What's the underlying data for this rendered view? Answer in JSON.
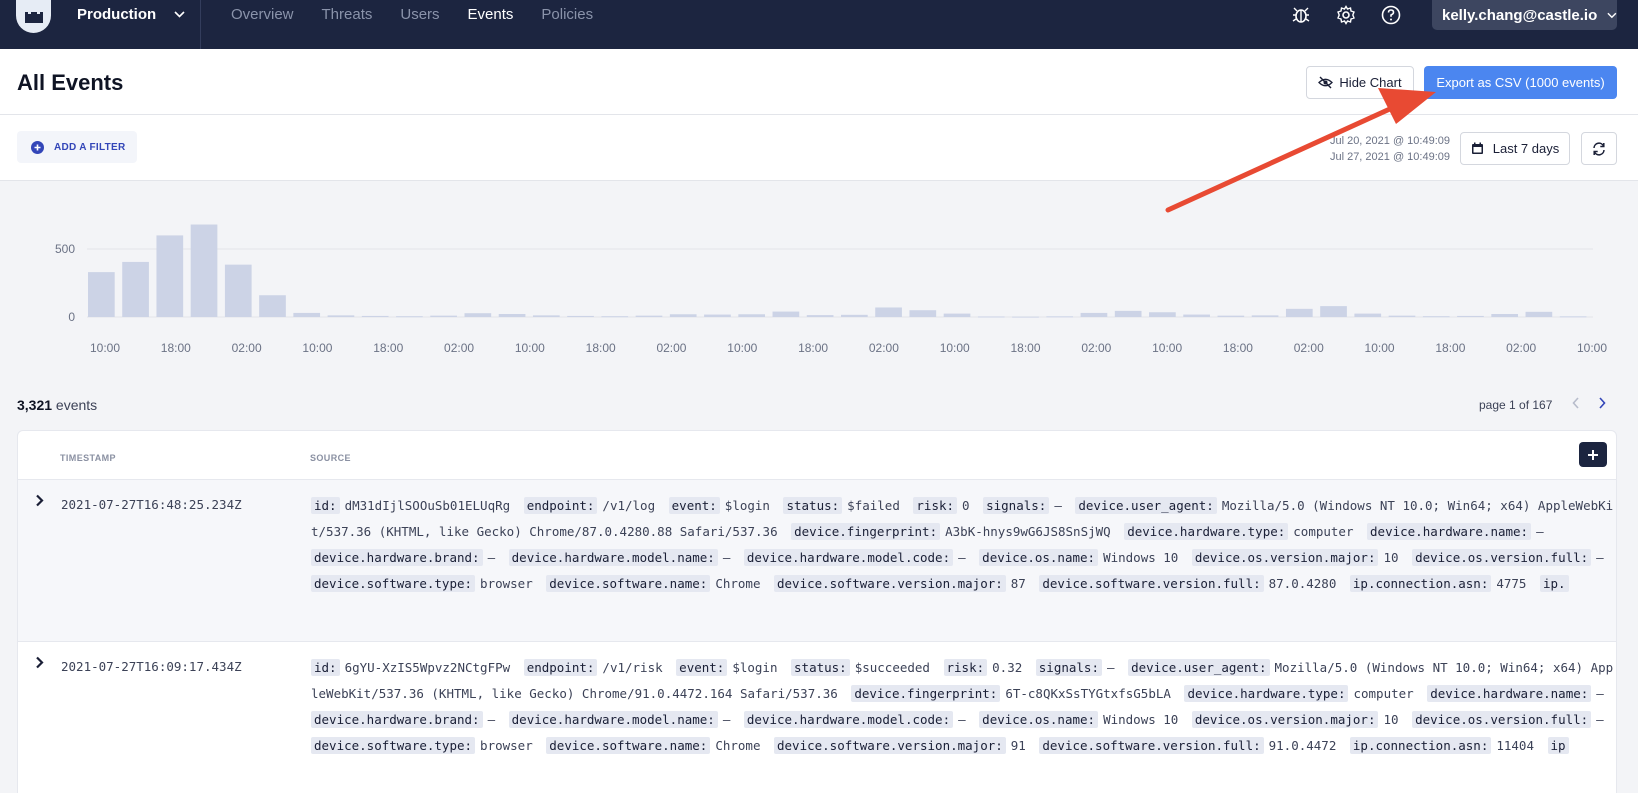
{
  "nav": {
    "environment": "Production",
    "tabs": [
      {
        "label": "Overview",
        "active": false
      },
      {
        "label": "Threats",
        "active": false
      },
      {
        "label": "Users",
        "active": false
      },
      {
        "label": "Events",
        "active": true
      },
      {
        "label": "Policies",
        "active": false
      }
    ],
    "icons": [
      "bug-icon",
      "gear-icon",
      "help-icon"
    ],
    "user": "kelly.chang@castle.io"
  },
  "header": {
    "title": "All Events",
    "hide_chart": "Hide Chart",
    "export": "Export as CSV (1000 events)"
  },
  "filters": {
    "add_filter": "ADD A FILTER",
    "range_start": "Jul 20, 2021 @ 10:49:09",
    "range_end": "Jul 27, 2021 @ 10:49:09",
    "range_label": "Last 7 days"
  },
  "chart_data": {
    "type": "bar",
    "ylim": [
      0,
      1000
    ],
    "yticks": [
      "500",
      "0"
    ],
    "xticks": [
      "10:00",
      "18:00",
      "02:00",
      "10:00",
      "18:00",
      "02:00",
      "10:00",
      "18:00",
      "02:00",
      "10:00",
      "18:00",
      "02:00",
      "10:00",
      "18:00",
      "02:00",
      "10:00",
      "18:00",
      "02:00",
      "10:00",
      "18:00",
      "02:00",
      "10:00"
    ],
    "values": [
      330,
      405,
      600,
      680,
      385,
      160,
      30,
      12,
      8,
      6,
      10,
      28,
      22,
      12,
      8,
      6,
      10,
      20,
      18,
      20,
      40,
      14,
      16,
      70,
      50,
      25,
      4,
      3,
      5,
      30,
      45,
      35,
      18,
      10,
      12,
      60,
      80,
      25,
      10,
      6,
      8,
      22,
      38,
      5
    ],
    "bar_color": "#ccd3e6"
  },
  "summary": {
    "count": "3,321",
    "count_suffix": " events",
    "page": "page 1 of 167"
  },
  "table": {
    "columns": [
      "TIMESTAMP",
      "SOURCE"
    ],
    "rows": [
      {
        "timestamp": "2021-07-27T16:48:25.234Z",
        "fields": [
          {
            "k": "id:",
            "v": "dM31dIjlSOOuSb01ELUqRg"
          },
          {
            "k": "endpoint:",
            "v": "/v1/log"
          },
          {
            "k": "event:",
            "v": "$login"
          },
          {
            "k": "status:",
            "v": "$failed"
          },
          {
            "k": "risk:",
            "v": "0"
          },
          {
            "k": "signals:",
            "v": "–"
          },
          {
            "k": "device.user_agent:",
            "v": "Mozilla/5.0 (Windows NT 10.0; Win64; x64) AppleWebKit/537.36 (KHTML, like Gecko) Chrome/87.0.4280.88 Safari/537.36",
            "wrap": true
          },
          {
            "k": "device.fingerprint:",
            "v": "A3bK-hnys9wG6JS8SnSjWQ",
            "wrap": true
          },
          {
            "k": "device.hardware.type:",
            "v": "computer"
          },
          {
            "k": "device.hardware.name:",
            "v": "–"
          },
          {
            "k": "device.hardware.brand:",
            "v": "–"
          },
          {
            "k": "device.hardware.model.name:",
            "v": "–"
          },
          {
            "k": "device.hardware.model.code:",
            "v": "–"
          },
          {
            "k": "device.os.name:",
            "v": "Windows 10"
          },
          {
            "k": "device.os.version.major:",
            "v": "10"
          },
          {
            "k": "device.os.version.full:",
            "v": "–"
          },
          {
            "k": "device.software.type:",
            "v": "browser"
          },
          {
            "k": "device.software.name:",
            "v": "Chrome"
          },
          {
            "k": "device.software.version.major:",
            "v": "87"
          },
          {
            "k": "device.software.version.full:",
            "v": "87.0.4280"
          },
          {
            "k": "ip.connection.asn:",
            "v": "4775"
          },
          {
            "k": "ip.",
            "v": ""
          }
        ]
      },
      {
        "timestamp": "2021-07-27T16:09:17.434Z",
        "fields": [
          {
            "k": "id:",
            "v": "6gYU-XzIS5Wpvz2NCtgFPw"
          },
          {
            "k": "endpoint:",
            "v": "/v1/risk"
          },
          {
            "k": "event:",
            "v": "$login"
          },
          {
            "k": "status:",
            "v": "$succeeded"
          },
          {
            "k": "risk:",
            "v": "0.32"
          },
          {
            "k": "signals:",
            "v": "–"
          },
          {
            "k": "device.user_agent:",
            "v": "Mozilla/5.0 (Windows NT 10.0; Win64; x64) AppleWebKit/537.36 (KHTML, like Gecko) Chrome/91.0.4472.164 Safari/537.36",
            "wrap": true
          },
          {
            "k": "device.fingerprint:",
            "v": "6T-c8QKxSsTYGtxfsG5bLA",
            "wrap": true
          },
          {
            "k": "device.hardware.type:",
            "v": "computer"
          },
          {
            "k": "device.hardware.name:",
            "v": "–"
          },
          {
            "k": "device.hardware.brand:",
            "v": "–"
          },
          {
            "k": "device.hardware.model.name:",
            "v": "–"
          },
          {
            "k": "device.hardware.model.code:",
            "v": "–"
          },
          {
            "k": "device.os.name:",
            "v": "Windows 10"
          },
          {
            "k": "device.os.version.major:",
            "v": "10"
          },
          {
            "k": "device.os.version.full:",
            "v": "–"
          },
          {
            "k": "device.software.type:",
            "v": "browser"
          },
          {
            "k": "device.software.name:",
            "v": "Chrome"
          },
          {
            "k": "device.software.version.major:",
            "v": "91"
          },
          {
            "k": "device.software.version.full:",
            "v": "91.0.4472"
          },
          {
            "k": "ip.connection.asn:",
            "v": "11404"
          },
          {
            "k": "ip",
            "v": ""
          }
        ]
      }
    ]
  },
  "annotation": {
    "arrow_color": "#e84a33"
  }
}
